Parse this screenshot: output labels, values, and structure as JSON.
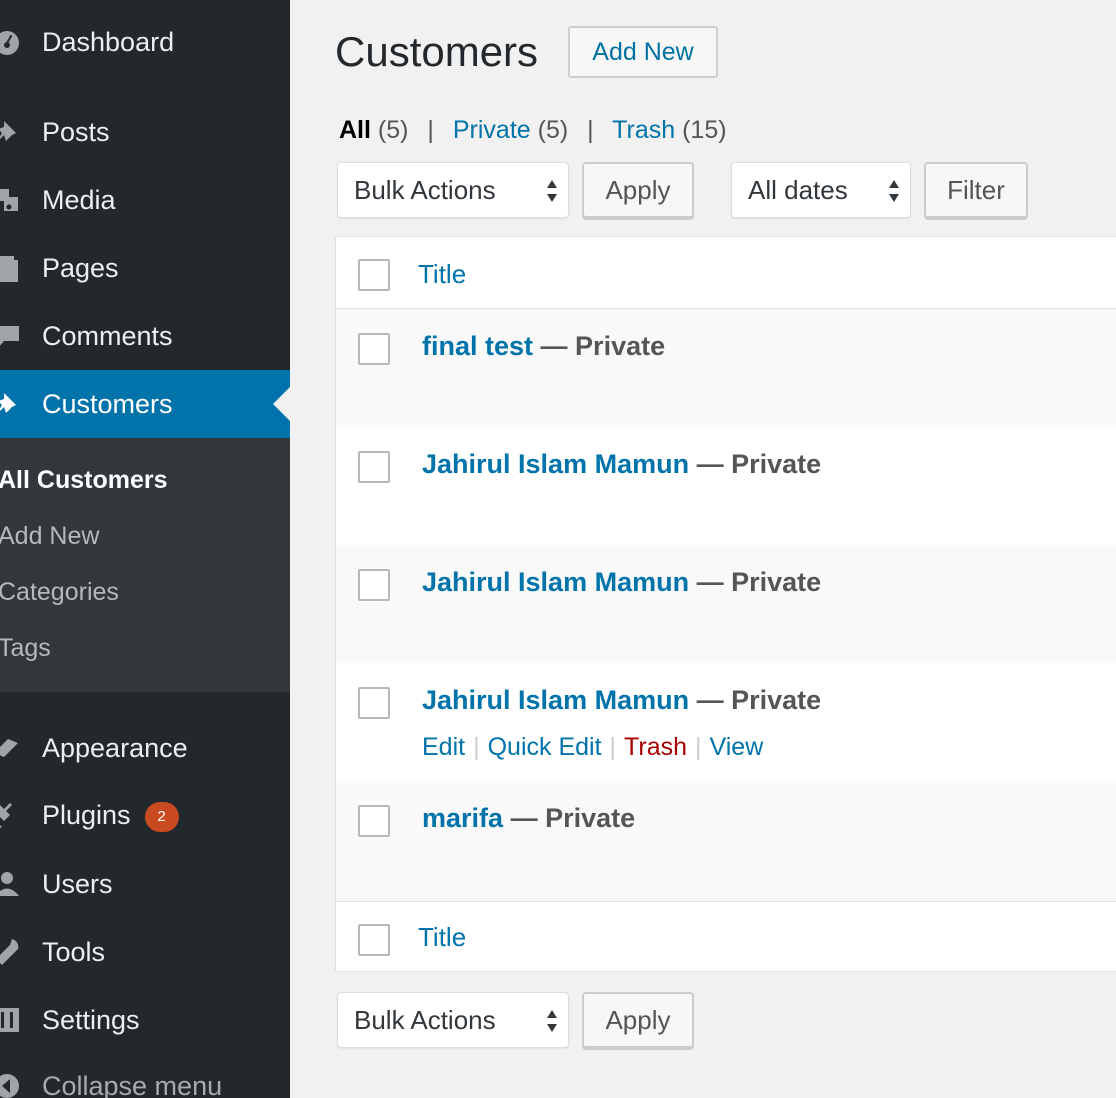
{
  "sidebar": {
    "items": [
      {
        "label": "Dashboard",
        "icon": "dashboard-icon"
      },
      {
        "label": "Posts",
        "icon": "pin-icon"
      },
      {
        "label": "Media",
        "icon": "media-icon"
      },
      {
        "label": "Pages",
        "icon": "pages-icon"
      },
      {
        "label": "Comments",
        "icon": "comment-icon"
      },
      {
        "label": "Customers",
        "icon": "pin-icon"
      },
      {
        "label": "Appearance",
        "icon": "brush-icon"
      },
      {
        "label": "Plugins",
        "icon": "plug-icon",
        "badge": "2"
      },
      {
        "label": "Users",
        "icon": "user-icon"
      },
      {
        "label": "Tools",
        "icon": "wrench-icon"
      },
      {
        "label": "Settings",
        "icon": "settings-icon"
      },
      {
        "label": "Collapse menu",
        "icon": "collapse-icon"
      }
    ],
    "submenu": [
      "All Customers",
      "Add New",
      "Categories",
      "Tags"
    ]
  },
  "colors": {
    "sidebar": "#23282d",
    "submenu": "#32373c",
    "accent": "#0073aa",
    "badge": "#ca4a1f",
    "trash": "#aa0000"
  },
  "header": {
    "title": "Customers",
    "add_new": "Add New"
  },
  "views": {
    "all_label": "All",
    "all_count": "(5)",
    "private_label": "Private",
    "private_count": "(5)",
    "trash_label": "Trash",
    "trash_count": "(15)",
    "sep": "|"
  },
  "filters": {
    "bulk_actions": "Bulk Actions",
    "apply": "Apply",
    "dates": "All dates",
    "filter": "Filter"
  },
  "table": {
    "column_title": "Title",
    "rows": [
      {
        "title": "final test",
        "state": "— Private"
      },
      {
        "title": "Jahirul Islam Mamun",
        "state": "— Private"
      },
      {
        "title": "Jahirul Islam Mamun",
        "state": "— Private"
      },
      {
        "title": "Jahirul Islam Mamun",
        "state": "— Private"
      },
      {
        "title": "marifa",
        "state": "— Private"
      }
    ],
    "row_actions": {
      "edit": "Edit",
      "quick_edit": "Quick Edit",
      "trash": "Trash",
      "view": "View",
      "sep": "|"
    }
  }
}
